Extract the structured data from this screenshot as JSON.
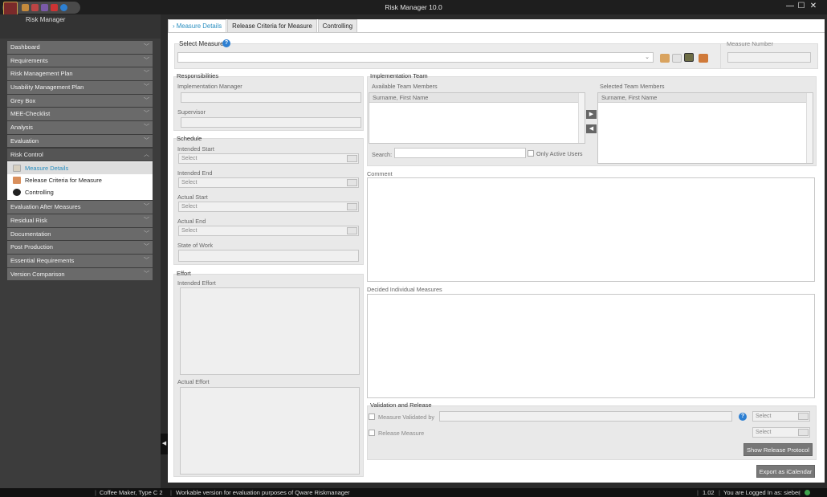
{
  "window": {
    "title": "Risk Manager   10.0",
    "app_name": "Risk Manager",
    "minimize": "—",
    "maximize": "☐",
    "close": "✕"
  },
  "nav": {
    "items_before": [
      "Dashboard",
      "Requirements",
      "Risk Management Plan",
      "Usability Management Plan",
      "Grey Box",
      "MEE-Checklist",
      "Analysis",
      "Evaluation"
    ],
    "active": "Risk Control",
    "sub": [
      "Measure Details",
      "Release Criteria for Measure",
      "Controlling"
    ],
    "items_after": [
      "Evaluation After Measures",
      "Residual Risk",
      "Documentation",
      "Post Production",
      "Essential Requirements",
      "Version Comparison"
    ]
  },
  "tabs": [
    "Measure Details",
    "Release Criteria for Measure",
    "Controlling"
  ],
  "select_measure": {
    "label": "Select Measure",
    "value": ""
  },
  "measure_number": {
    "label": "Measure Number",
    "value": ""
  },
  "responsibilities": {
    "title": "Responsibilities",
    "impl_manager": "Implementation Manager",
    "supervisor": "Supervisor"
  },
  "schedule": {
    "title": "Schedule",
    "intended_start": "Intended Start",
    "intended_end": "Intended End",
    "actual_start": "Actual Start",
    "actual_end": "Actual End",
    "state_of_work": "State of Work",
    "select_placeholder": "Select"
  },
  "effort": {
    "title": "Effort",
    "intended": "Intended Effort",
    "actual": "Actual Effort"
  },
  "team": {
    "title": "Implementation Team",
    "available": "Available Team Members",
    "selected": "Selected Team Members",
    "column": "Surname, First Name",
    "search_label": "Search:",
    "only_active": "Only Active Users",
    "add": "▶",
    "remove": "◀"
  },
  "comment_label": "Comment",
  "decided_label": "Decided Individual Measures",
  "validation": {
    "title": "Validation and Release",
    "validated_by": "Measure Validated by",
    "release_measure": "Release Measure",
    "select_placeholder": "Select",
    "show_protocol": "Show Release Protocol"
  },
  "export_button": "Export as iCalendar",
  "status": {
    "project": "Coffee Maker, Type C 2",
    "message": "Workable version for evaluation purposes of Qware Riskmanager",
    "version": "1.02",
    "user": "You are Logged In as: sieber"
  },
  "colors": {
    "accent": "#2a8fc0",
    "sidebar": "#3c3c3c",
    "nav_item": "#6a6a6a",
    "help": "#2d7fd2"
  }
}
